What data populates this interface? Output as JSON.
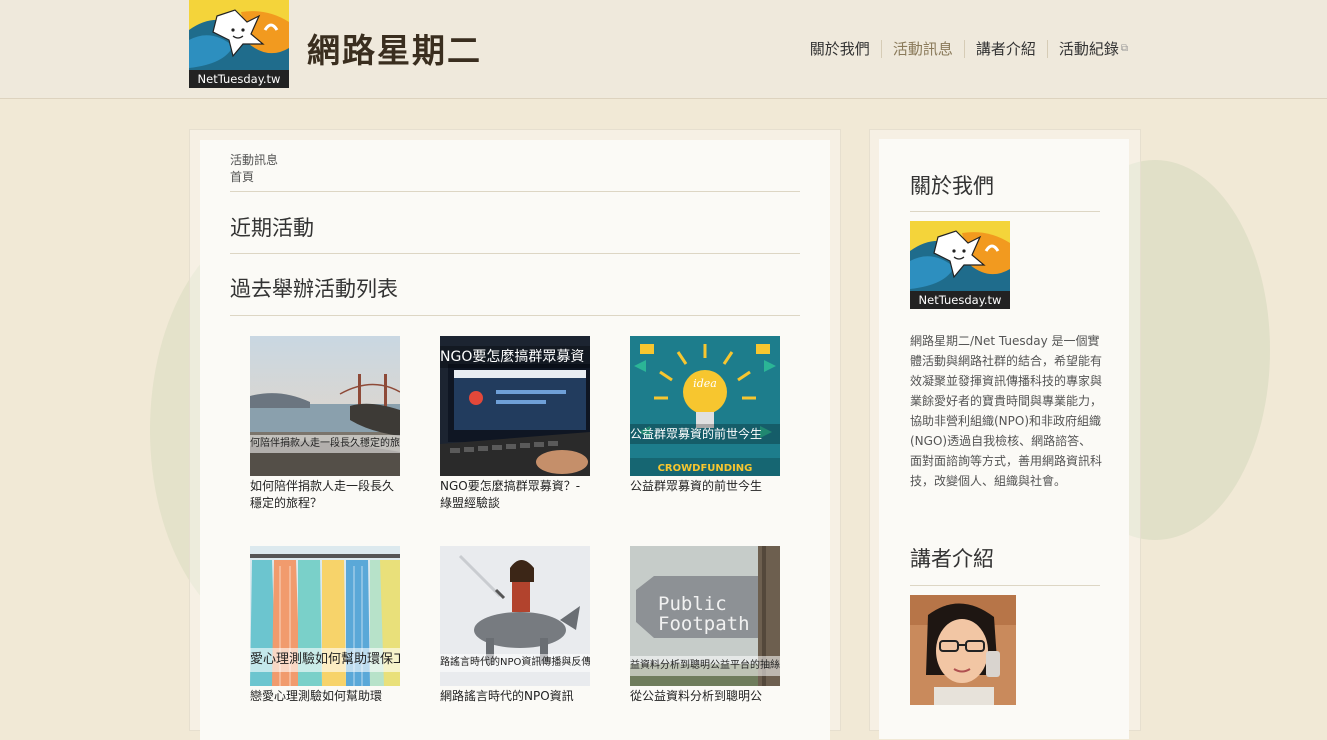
{
  "header": {
    "logo_text": "NetTuesday.tw",
    "site_title": "網路星期二",
    "nav": [
      {
        "label": "關於我們",
        "active": false
      },
      {
        "label": "活動訊息",
        "active": true
      },
      {
        "label": "講者介紹",
        "active": false
      },
      {
        "label": "活動紀錄",
        "active": false,
        "external_icon": "external-link-icon"
      }
    ]
  },
  "main": {
    "breadcrumb": {
      "current": "活動訊息",
      "home": "首頁"
    },
    "recent_heading": "近期活動",
    "past_heading": "過去舉辦活動列表",
    "cards": [
      {
        "title": "如何陪伴捐款人走一段長久穩定的旅程？",
        "overlay": "何陪伴捐款人走一段長久穩定的旅"
      },
      {
        "title": "NGO要怎麼搞群眾募資？- 綠盟經驗談",
        "overlay": "NGO要怎麼搞群眾募資"
      },
      {
        "title": "公益群眾募資的前世今生",
        "overlay": "公益群眾募資的前世今生",
        "overlay2": "CROWDFUNDING",
        "bulb_text": "idea"
      },
      {
        "title": "戀愛心理測驗如何幫助環",
        "overlay": "愛心理測驗如何幫助環保工作"
      },
      {
        "title": "網路謠言時代的NPO資訊",
        "overlay": "路謠言時代的NPO資訊傳播與反傳"
      },
      {
        "title": "從公益資料分析到聰明公",
        "overlay": "益資料分析到聰明公益平台的抽絲剝",
        "sign_line1": "Public",
        "sign_line2": "Footpath"
      }
    ]
  },
  "sidebar": {
    "about_heading": "關於我們",
    "logo_text": "NetTuesday.tw",
    "about_text": "網路星期二/Net Tuesday 是一個實體活動與網路社群的結合，希望能有效凝聚並發揮資訊傳播科技的專家與業餘愛好者的寶貴時間與專業能力，協助非營利組織(NPO)和非政府組織(NGO)透過自我檢核、網路諮答、面對面諮詢等方式，善用網路資訊科技，改變個人、組織與社會。",
    "speakers_heading": "講者介紹"
  }
}
